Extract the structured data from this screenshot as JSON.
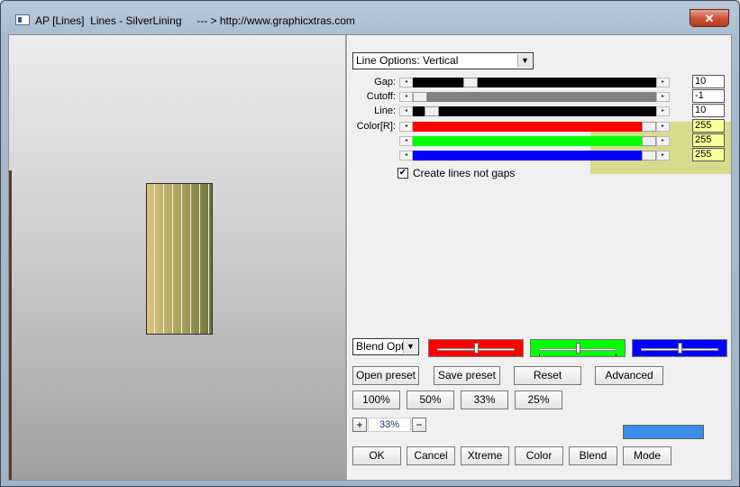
{
  "window": {
    "title": "AP [Lines]  Lines - SilverLining     --- > http://www.graphicxtras.com",
    "close_label": "✕"
  },
  "options": {
    "line_options": "Line Options: Vertical",
    "blend_options": "Blend Opti"
  },
  "sliders": [
    {
      "label": "Gap:",
      "value": "10",
      "track_color": "#000000",
      "fraction": 0.22
    },
    {
      "label": "Cutoff:",
      "value": "-1",
      "track_color": "#808080",
      "fraction": 0.0
    },
    {
      "label": "Line:",
      "value": "10",
      "track_color": "#000000",
      "fraction": 0.05
    },
    {
      "label": "Color[R]:",
      "value": "255",
      "track_color": "#ff0000",
      "fraction": 1.0
    },
    {
      "label": "",
      "value": "255",
      "track_color": "#00ff00",
      "fraction": 1.0
    },
    {
      "label": "",
      "value": "255",
      "track_color": "#0000ff",
      "fraction": 1.0
    }
  ],
  "checkbox": {
    "label": "Create lines not gaps",
    "checked": true,
    "mark": "✔"
  },
  "blend_sliders": [
    {
      "color": "#ff0000",
      "fraction": 0.5
    },
    {
      "color": "#00ff00",
      "fraction": 0.5
    },
    {
      "color": "#0000ff",
      "fraction": 0.5
    }
  ],
  "buttons": {
    "open_preset": "Open preset",
    "save_preset": "Save preset",
    "reset": "Reset",
    "advanced": "Advanced",
    "zoom100": "100%",
    "zoom50": "50%",
    "zoom33": "33%",
    "zoom25": "25%",
    "plus": "+",
    "minus": "−",
    "zoom_value": "33%",
    "ok": "OK",
    "cancel": "Cancel",
    "xtreme": "Xtreme",
    "color": "Color",
    "blend": "Blend",
    "mode": "Mode"
  },
  "colors": {
    "swatch": "#3c8ee8",
    "highlight": "rgba(200,200,60,0.55)"
  },
  "icons": {
    "app": "app-window-icon",
    "close": "close-icon",
    "dropdown": "chevron-down-icon",
    "scroll_left": "arrow-left-icon",
    "scroll_right": "arrow-right-icon",
    "check": "checkmark-icon"
  }
}
